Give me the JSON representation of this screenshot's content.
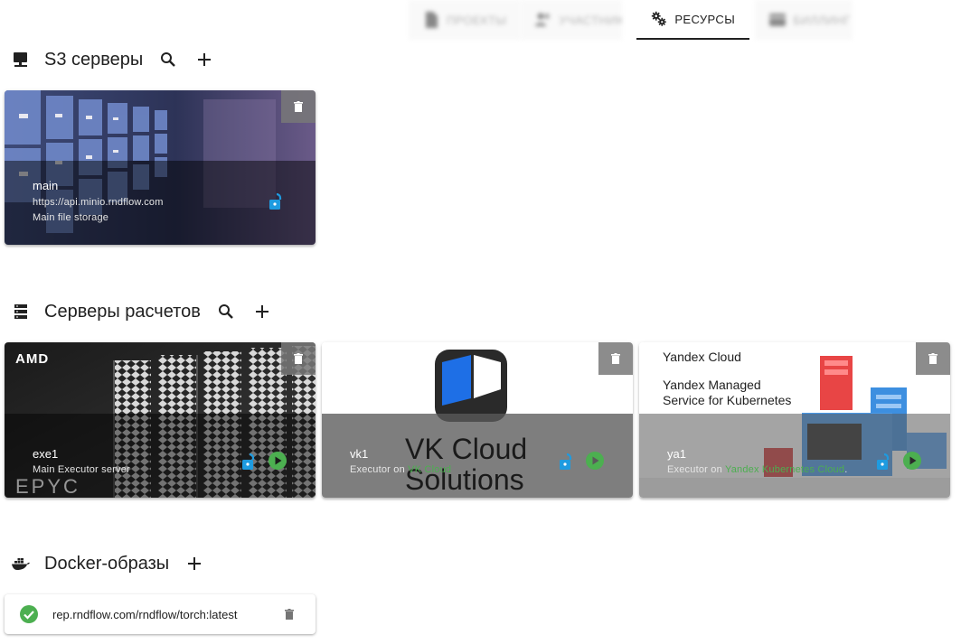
{
  "tabs": [
    {
      "label": "ПРОЕКТЫ",
      "icon": "document-icon"
    },
    {
      "label": "УЧАСТНИКИ",
      "icon": "people-icon"
    },
    {
      "label": "РЕСУРСЫ",
      "icon": "gears-icon"
    },
    {
      "label": "БИЛЛИНГ",
      "icon": "card-icon"
    }
  ],
  "active_tab": "РЕСУРСЫ",
  "s3": {
    "title": "S3 серверы",
    "icon": "storage-server-icon",
    "cards": [
      {
        "name": "main",
        "url": "https://api.minio.rndflow.com",
        "description": "Main file storage"
      }
    ]
  },
  "compute": {
    "title": "Серверы расчетов",
    "icon": "server-rack-icon",
    "cards": [
      {
        "name": "exe1",
        "description": "Main Executor server",
        "image_text": [
          "AMD",
          "EPYC"
        ]
      },
      {
        "name": "vk1",
        "description_prefix": "Executor on ",
        "link": "VK Cloud",
        "image_text": [
          "VK Cloud",
          "Solutions"
        ]
      },
      {
        "name": "ya1",
        "description_prefix": "Executor on ",
        "link": "Yandex Kubernetes Cloud",
        "description_suffix": ".",
        "image_text": [
          "Yandex Cloud",
          "Yandex Managed",
          "Service for Kubernetes"
        ]
      }
    ]
  },
  "docker": {
    "title": "Docker-образы",
    "icon": "docker-whale-icon",
    "items": [
      {
        "name": "rep.rndflow.com/rndflow/torch:latest",
        "status": "ok"
      }
    ]
  },
  "colors": {
    "accent_blue": "#1e9be0",
    "accent_green": "#4caf50",
    "text": "#212121"
  }
}
